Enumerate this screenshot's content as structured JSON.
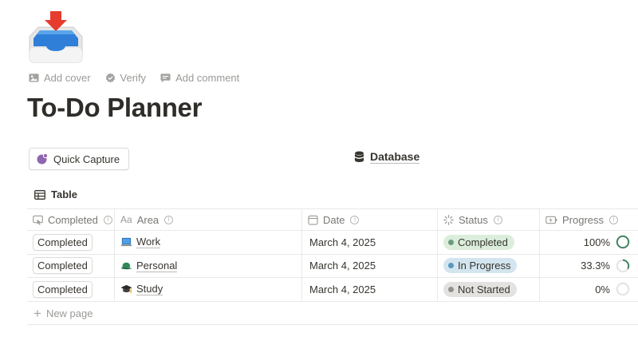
{
  "page": {
    "icon": "inbox-tray-icon",
    "controls": [
      {
        "label": "Add cover",
        "icon": "image-icon"
      },
      {
        "label": "Verify",
        "icon": "verified-badge-icon"
      },
      {
        "label": "Add comment",
        "icon": "comment-icon"
      }
    ],
    "title": "To-Do Planner"
  },
  "quick_capture": {
    "label": "Quick Capture",
    "icon": "quick-capture-icon",
    "accent": "#9065b0"
  },
  "database_link": {
    "label": "Database",
    "icon": "database-icon"
  },
  "view": {
    "label": "Table",
    "icon": "table-icon"
  },
  "table": {
    "columns": [
      {
        "label": "Completed",
        "icon": "button-icon"
      },
      {
        "label": "Area",
        "icon": "text-property-icon",
        "prefix": "Aa"
      },
      {
        "label": "Date",
        "icon": "calendar-icon"
      },
      {
        "label": "Status",
        "icon": "status-icon"
      },
      {
        "label": "Progress",
        "icon": "battery-icon"
      }
    ],
    "rows": [
      {
        "button": "Completed",
        "area": "Work",
        "area_icon": "laptop-icon",
        "date": "March 4, 2025",
        "status": "Completed",
        "status_bg": "#dbeddb",
        "status_dot": "#6c9b7d",
        "progress": "100%",
        "progress_value": 1.0
      },
      {
        "button": "Completed",
        "area": "Personal",
        "area_icon": "cap-icon",
        "date": "March 4, 2025",
        "status": "In Progress",
        "status_bg": "#d3e5ef",
        "status_dot": "#5b97bd",
        "progress": "33.3%",
        "progress_value": 0.333
      },
      {
        "button": "Completed",
        "area": "Study",
        "area_icon": "graduation-cap-icon",
        "date": "March 4, 2025",
        "status": "Not Started",
        "status_bg": "#e3e2e0",
        "status_dot": "#91918e",
        "progress": "0%",
        "progress_value": 0.0
      }
    ]
  },
  "new_page": {
    "label": "New page"
  },
  "colors": {
    "progress_ring": "#448361",
    "ring_track": "#e3e2e0"
  }
}
